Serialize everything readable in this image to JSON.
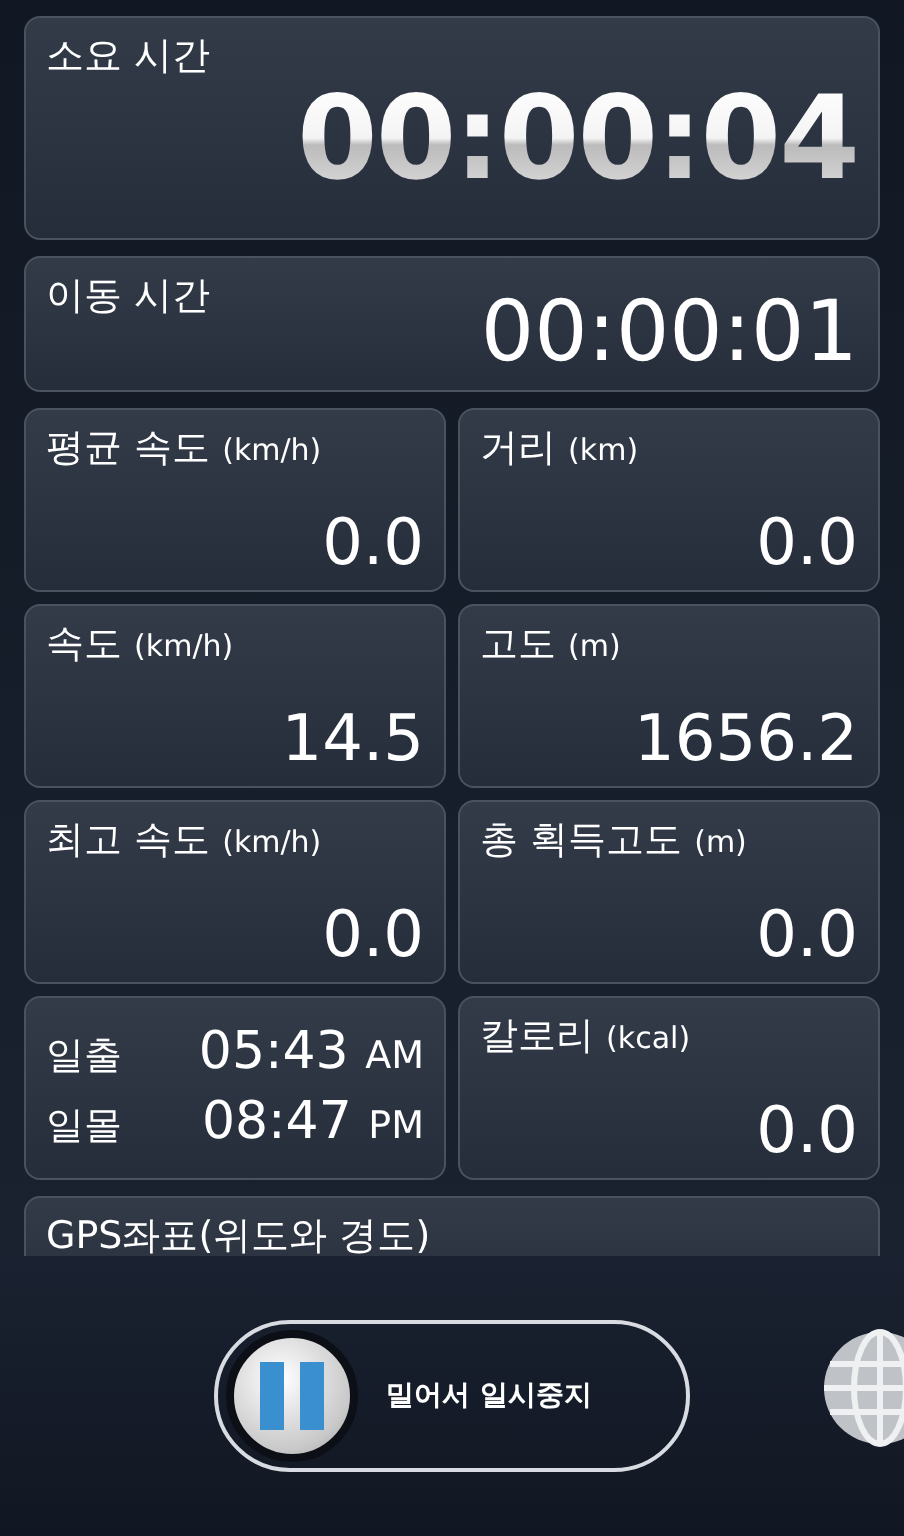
{
  "elapsed_time": {
    "label": "소요 시간",
    "value": "00:00:04"
  },
  "moving_time": {
    "label": "이동 시간",
    "value": "00:00:01"
  },
  "tiles": [
    {
      "kind": "stat",
      "label": "평균 속도",
      "unit": "(km/h)",
      "value": "0.0"
    },
    {
      "kind": "stat",
      "label": "거리",
      "unit": "(km)",
      "value": "0.0"
    },
    {
      "kind": "stat",
      "label": "속도",
      "unit": "(km/h)",
      "value": "14.5"
    },
    {
      "kind": "stat",
      "label": "고도",
      "unit": "(m)",
      "value": "1656.2"
    },
    {
      "kind": "stat",
      "label": "최고 속도",
      "unit": "(km/h)",
      "value": "0.0"
    },
    {
      "kind": "stat",
      "label": "총 획득고도",
      "unit": "(m)",
      "value": "0.0"
    },
    {
      "kind": "sun",
      "rows": [
        {
          "label": "일출",
          "time": "05:43",
          "suffix": "AM"
        },
        {
          "label": "일몰",
          "time": "08:47",
          "suffix": "PM"
        }
      ]
    },
    {
      "kind": "stat",
      "label": "칼로리",
      "unit": "(kcal)",
      "value": "0.0"
    }
  ],
  "gps": {
    "label": "GPS좌표(위도와 경도)"
  },
  "slider": {
    "label": "밀어서 일시중지"
  }
}
